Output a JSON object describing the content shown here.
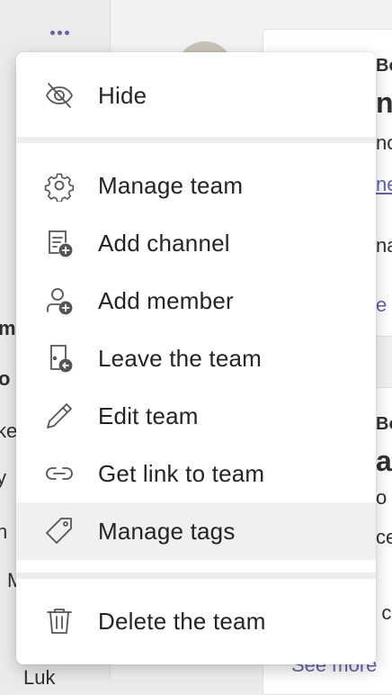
{
  "menu": {
    "items": [
      {
        "id": "hide",
        "label": "Hide",
        "icon": "eye-off-icon"
      },
      {
        "id": "manage-team",
        "label": "Manage team",
        "icon": "gear-icon"
      },
      {
        "id": "add-channel",
        "label": "Add channel",
        "icon": "add-channel-icon"
      },
      {
        "id": "add-member",
        "label": "Add member",
        "icon": "add-member-icon"
      },
      {
        "id": "leave-team",
        "label": "Leave the team",
        "icon": "leave-icon"
      },
      {
        "id": "edit-team",
        "label": "Edit team",
        "icon": "pencil-icon"
      },
      {
        "id": "get-link",
        "label": "Get link to team",
        "icon": "link-icon"
      },
      {
        "id": "manage-tags",
        "label": "Manage tags",
        "icon": "tag-icon",
        "selected": true
      },
      {
        "id": "delete-team",
        "label": "Delete the team",
        "icon": "trash-icon"
      }
    ]
  },
  "background": {
    "left_fragments": [
      "m",
      "o",
      "ke",
      "y",
      "n",
      "M",
      "Luk"
    ],
    "right_fragments": [
      "Bo",
      "n",
      "no",
      "ne",
      "na",
      "e",
      "Bo",
      "a",
      "o",
      "ce",
      "e c",
      "See more"
    ]
  },
  "colors": {
    "accent": "#6264a7",
    "selected_row": "#f0f0f0"
  }
}
